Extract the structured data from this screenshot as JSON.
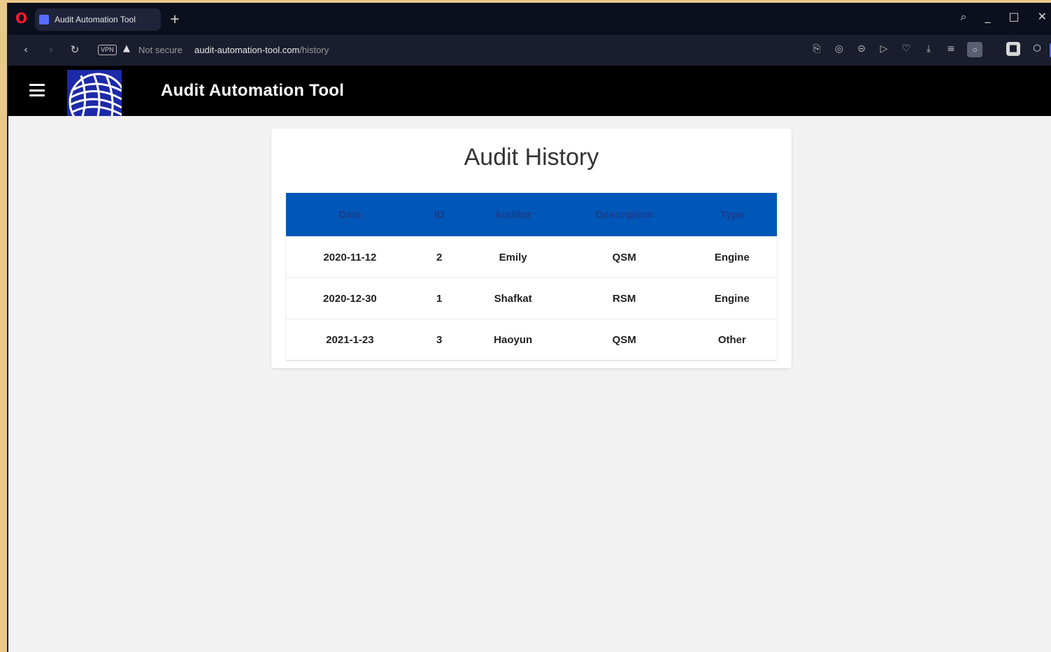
{
  "browser": {
    "tab_title": "Audit Automation Tool",
    "new_tab_symbol": "+",
    "vpn_label": "VPN",
    "security_label": "Not secure",
    "url_host": "audit-automation-tool.com",
    "url_path": "/history",
    "window_controls": [
      "search-icon",
      "minimize-icon",
      "maximize-icon",
      "close-icon"
    ],
    "toolbar_icons": [
      "screenshot-icon",
      "camera-icon",
      "wallet-icon",
      "play-icon",
      "heart-icon",
      "download-icon",
      "easy-setup-icon"
    ]
  },
  "app": {
    "title": "Audit Automation Tool",
    "menu_icon": "hamburger-icon",
    "logo_icon": "globe-logo"
  },
  "page": {
    "heading": "Audit History",
    "table": {
      "headers": [
        "Date",
        "ID",
        "Auditor",
        "Description",
        "Type"
      ],
      "rows": [
        [
          "2020-11-12",
          "2",
          "Emily",
          "QSM",
          "Engine"
        ],
        [
          "2020-12-30",
          "1",
          "Shafkat",
          "RSM",
          "Engine"
        ],
        [
          "2021-1-23",
          "3",
          "Haoyun",
          "QSM",
          "Other"
        ]
      ]
    }
  },
  "colors": {
    "header_bg": "#000000",
    "table_header_bg": "#0057b8",
    "page_bg": "#f2f2f2"
  }
}
